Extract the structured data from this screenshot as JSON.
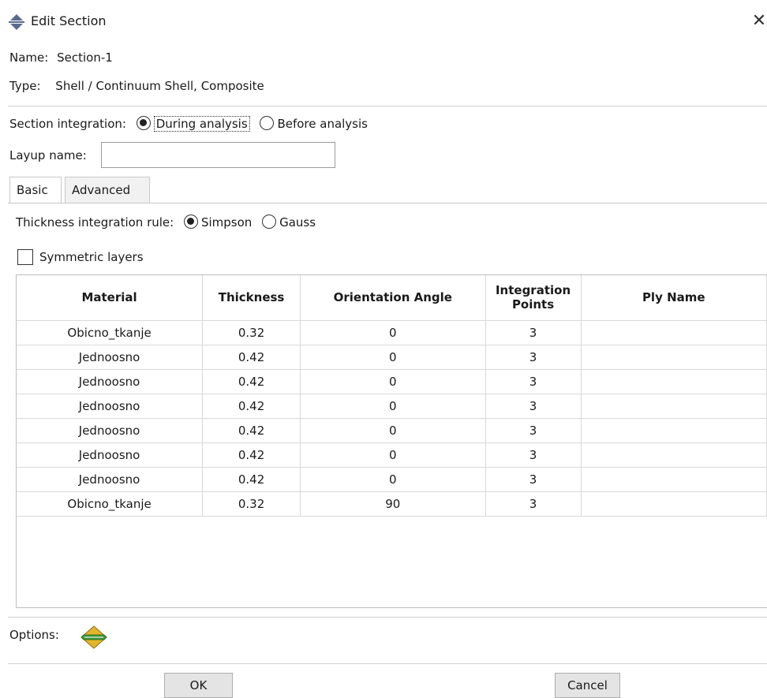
{
  "window": {
    "title": "Edit Section",
    "close_glyph": "✕"
  },
  "section": {
    "name_label": "Name:",
    "name_value": "Section-1",
    "type_label": "Type:",
    "type_value": "Shell / Continuum Shell, Composite"
  },
  "integration": {
    "label": "Section integration:",
    "options": [
      {
        "label": "During analysis",
        "selected": true
      },
      {
        "label": "Before analysis",
        "selected": false
      }
    ]
  },
  "layup": {
    "label": "Layup name:",
    "value": ""
  },
  "tabs": [
    {
      "label": "Basic",
      "active": true
    },
    {
      "label": "Advanced",
      "active": false
    }
  ],
  "thickness_rule": {
    "label": "Thickness integration rule:",
    "options": [
      {
        "label": "Simpson",
        "selected": true
      },
      {
        "label": "Gauss",
        "selected": false
      }
    ]
  },
  "symmetric": {
    "label": "Symmetric layers",
    "checked": false
  },
  "table": {
    "headers": [
      "Material",
      "Thickness",
      "Orientation Angle",
      "Integration Points",
      "Ply Name"
    ],
    "rows": [
      [
        "Obicno_tkanje",
        "0.32",
        "0",
        "3",
        ""
      ],
      [
        "Jednoosno",
        "0.42",
        "0",
        "3",
        ""
      ],
      [
        "Jednoosno",
        "0.42",
        "0",
        "3",
        ""
      ],
      [
        "Jednoosno",
        "0.42",
        "0",
        "3",
        ""
      ],
      [
        "Jednoosno",
        "0.42",
        "0",
        "3",
        ""
      ],
      [
        "Jednoosno",
        "0.42",
        "0",
        "3",
        ""
      ],
      [
        "Jednoosno",
        "0.42",
        "0",
        "3",
        ""
      ],
      [
        "Obicno_tkanje",
        "0.32",
        "90",
        "3",
        ""
      ]
    ]
  },
  "options": {
    "label": "Options:",
    "icon": "layers-options-icon"
  },
  "buttons": {
    "ok": "OK",
    "cancel": "Cancel"
  }
}
